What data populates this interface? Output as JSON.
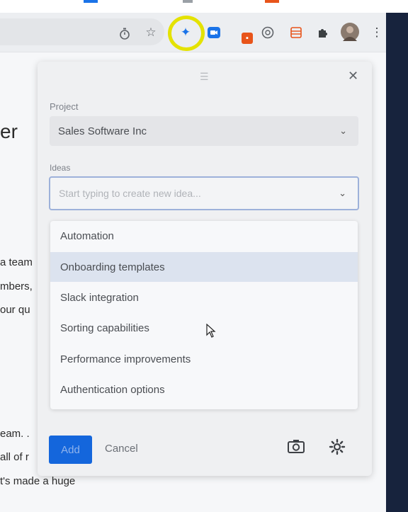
{
  "popup": {
    "project_label": "Project",
    "project_value": "Sales Software Inc",
    "ideas_label": "Ideas",
    "ideas_placeholder": "Start typing to create new idea...",
    "options": [
      "Automation",
      "Onboarding templates",
      "Slack integration",
      "Sorting capabilities",
      "Performance improvements",
      "Authentication options"
    ],
    "selected_option_index": 1,
    "add_label": "Add",
    "cancel_label": "Cancel"
  },
  "background_page": {
    "heading_fragment": "er",
    "line1": "a team",
    "line2": "mbers,",
    "line3": "our qu",
    "line4": "eam. .",
    "line5": "all of r",
    "line6": "t's made a huge"
  },
  "icons": {
    "toolbar": [
      "timer-icon",
      "star-icon",
      "sparkle-extension-icon",
      "video-icon",
      "red-extension-icon",
      "grammar-icon",
      "layout-extension-icon",
      "puzzle-icon",
      "avatar",
      "kebab-menu-icon"
    ],
    "popup": [
      "drag-handle-icon",
      "close-icon",
      "chevron-down-icon",
      "camera-icon",
      "gear-icon"
    ]
  },
  "colors": {
    "accent": "#1466dc",
    "highlight": "#e4e200",
    "sidebar": "#17233d"
  }
}
